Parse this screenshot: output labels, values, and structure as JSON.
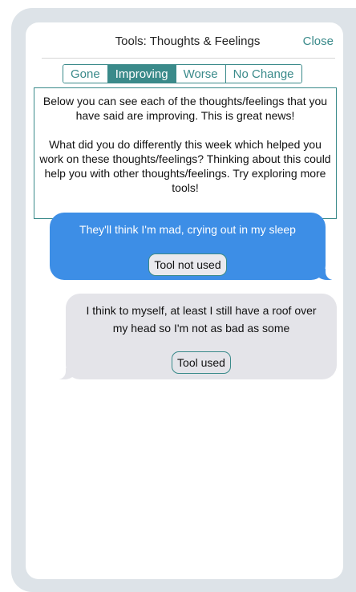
{
  "header": {
    "title": "Tools: Thoughts & Feelings",
    "close_label": "Close"
  },
  "segments": {
    "items": [
      "Gone",
      "Improving",
      "Worse",
      "No Change"
    ],
    "selected": "Improving"
  },
  "info": {
    "paragraph1": "Below you can see each of the thoughts/feelings that you have said are improving. This is great news!",
    "paragraph2": "What did you do differently this week which helped you work on these thoughts/feelings? Thinking about this could help you with other thoughts/feelings. Try exploring more tools!"
  },
  "messages": [
    {
      "text": "They'll think I'm mad, crying out in my sleep",
      "tool_label": "Tool not used"
    },
    {
      "text": "I think to myself, at least I still have a roof over my head so I'm not as bad as some",
      "tool_label": "Tool used"
    }
  ],
  "colors": {
    "accent": "#3a8a8a",
    "blue_bubble": "#3d8ee6",
    "gray_bubble": "#e4e4e9",
    "frame": "#dde3e8"
  }
}
